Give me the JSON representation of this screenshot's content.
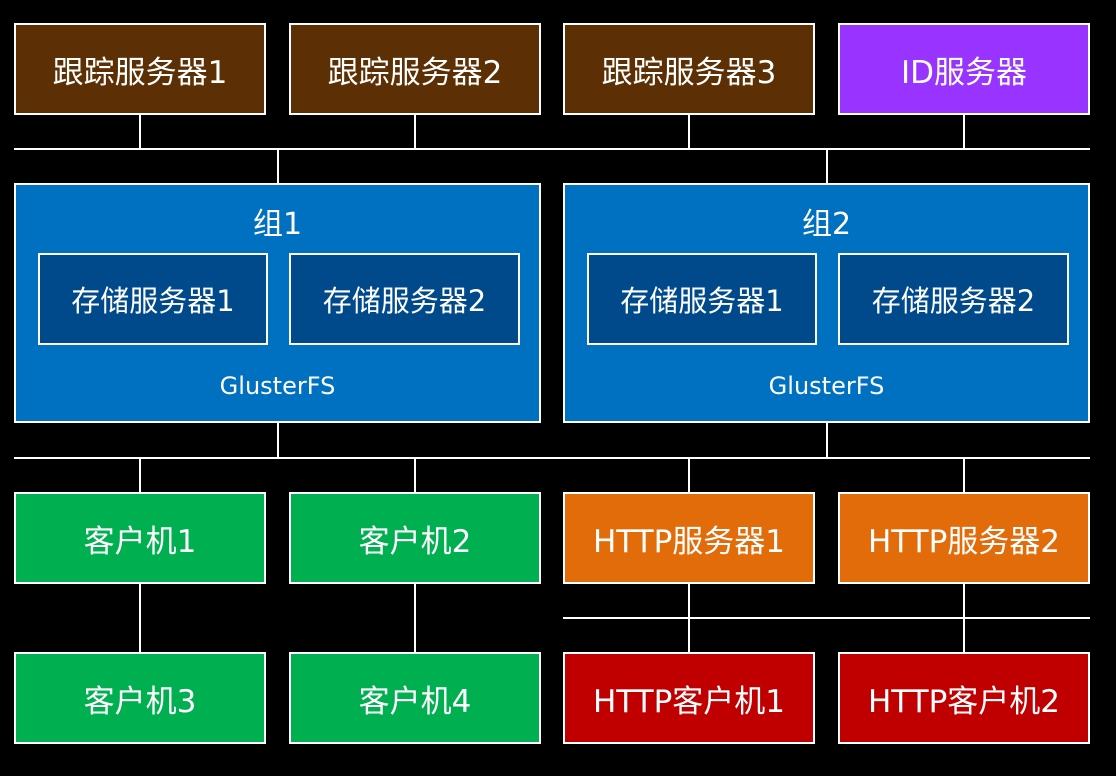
{
  "colors": {
    "background": "#000000",
    "tracker": "#5c3004",
    "id_server": "#9933ff",
    "group": "#0070c0",
    "storage": "#004a8c",
    "client": "#00b050",
    "http_server": "#e36c0a",
    "http_client": "#c00000",
    "line": "#ffffff"
  },
  "trackers": [
    {
      "label": "跟踪服务器1"
    },
    {
      "label": "跟踪服务器2"
    },
    {
      "label": "跟踪服务器3"
    }
  ],
  "id_server": {
    "label": "ID服务器"
  },
  "groups": [
    {
      "title": "组1",
      "subtitle": "GlusterFS",
      "storage": [
        {
          "label": "存储服务器1"
        },
        {
          "label": "存储服务器2"
        }
      ]
    },
    {
      "title": "组2",
      "subtitle": "GlusterFS",
      "storage": [
        {
          "label": "存储服务器1"
        },
        {
          "label": "存储服务器2"
        }
      ]
    }
  ],
  "clients": [
    {
      "label": "客户机1"
    },
    {
      "label": "客户机2"
    },
    {
      "label": "客户机3"
    },
    {
      "label": "客户机4"
    }
  ],
  "http_servers": [
    {
      "label": "HTTP服务器1"
    },
    {
      "label": "HTTP服务器2"
    }
  ],
  "http_clients": [
    {
      "label": "HTTP客户机1"
    },
    {
      "label": "HTTP客户机2"
    }
  ]
}
